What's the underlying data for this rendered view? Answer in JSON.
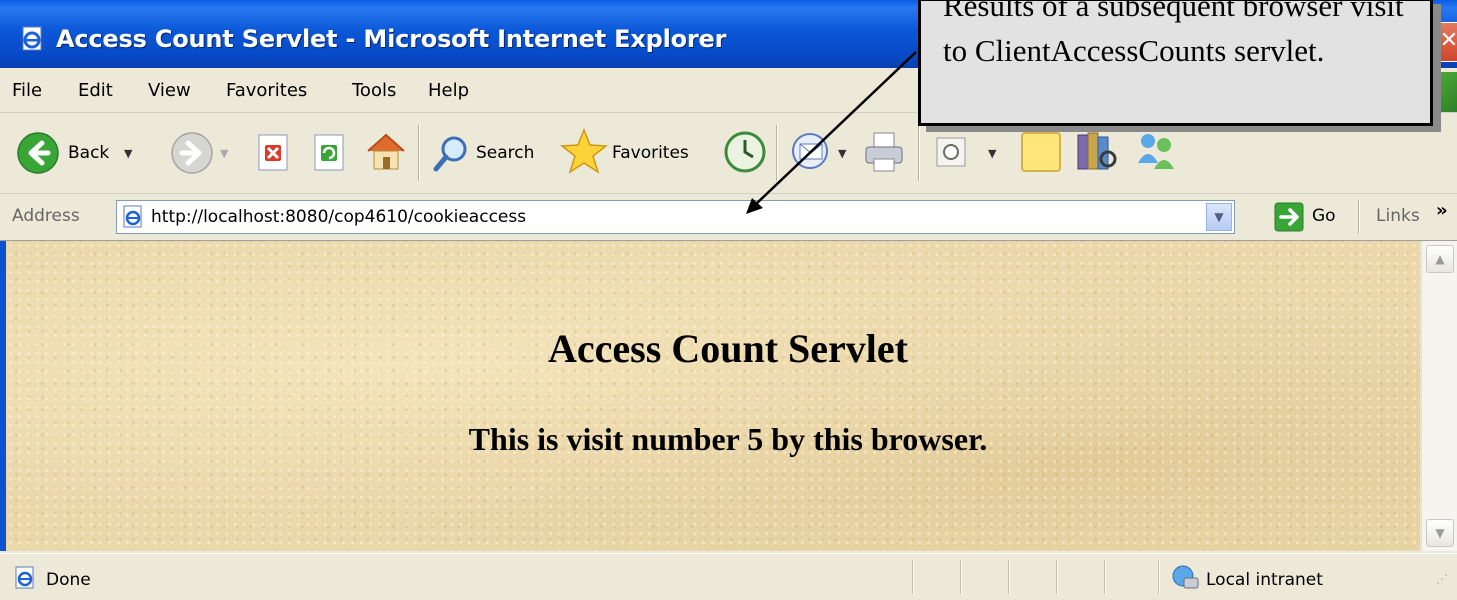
{
  "window": {
    "title": "Access Count Servlet - Microsoft Internet Explorer",
    "icon": "ie-page-icon",
    "close_icon": "close-icon"
  },
  "menu": {
    "items": [
      {
        "label": "File",
        "accel": "F"
      },
      {
        "label": "Edit",
        "accel": "E"
      },
      {
        "label": "View",
        "accel": "V"
      },
      {
        "label": "Favorites",
        "accel": "a"
      },
      {
        "label": "Tools",
        "accel": "T"
      },
      {
        "label": "Help",
        "accel": "H"
      }
    ]
  },
  "toolbar": {
    "back_label": "Back",
    "search_label": "Search",
    "favorites_label": "Favorites",
    "icons": [
      "back-icon",
      "forward-icon",
      "stop-icon",
      "refresh-icon",
      "home-icon",
      "search-icon",
      "favorites-star-icon",
      "history-icon",
      "mail-icon",
      "print-icon",
      "edit-icon",
      "notes-icon",
      "research-icon",
      "messenger-icon"
    ]
  },
  "address": {
    "label": "Address",
    "accel": "d",
    "url": "http://localhost:8080/cop4610/cookieaccess",
    "go_label": "Go",
    "links_label": "Links",
    "links_more": "»"
  },
  "page": {
    "heading": "Access Count Servlet",
    "subheading": "This is visit number 5 by this browser."
  },
  "status": {
    "text": "Done",
    "zone": "Local intranet"
  },
  "callout": {
    "text": "Results of a subsequent browser visit to ClientAccessCounts servlet."
  },
  "colors": {
    "titlebar": "#0b58d8",
    "chrome": "#ece9d8",
    "page_background": "#ead8ab",
    "callout_background": "#e2e2e2"
  }
}
